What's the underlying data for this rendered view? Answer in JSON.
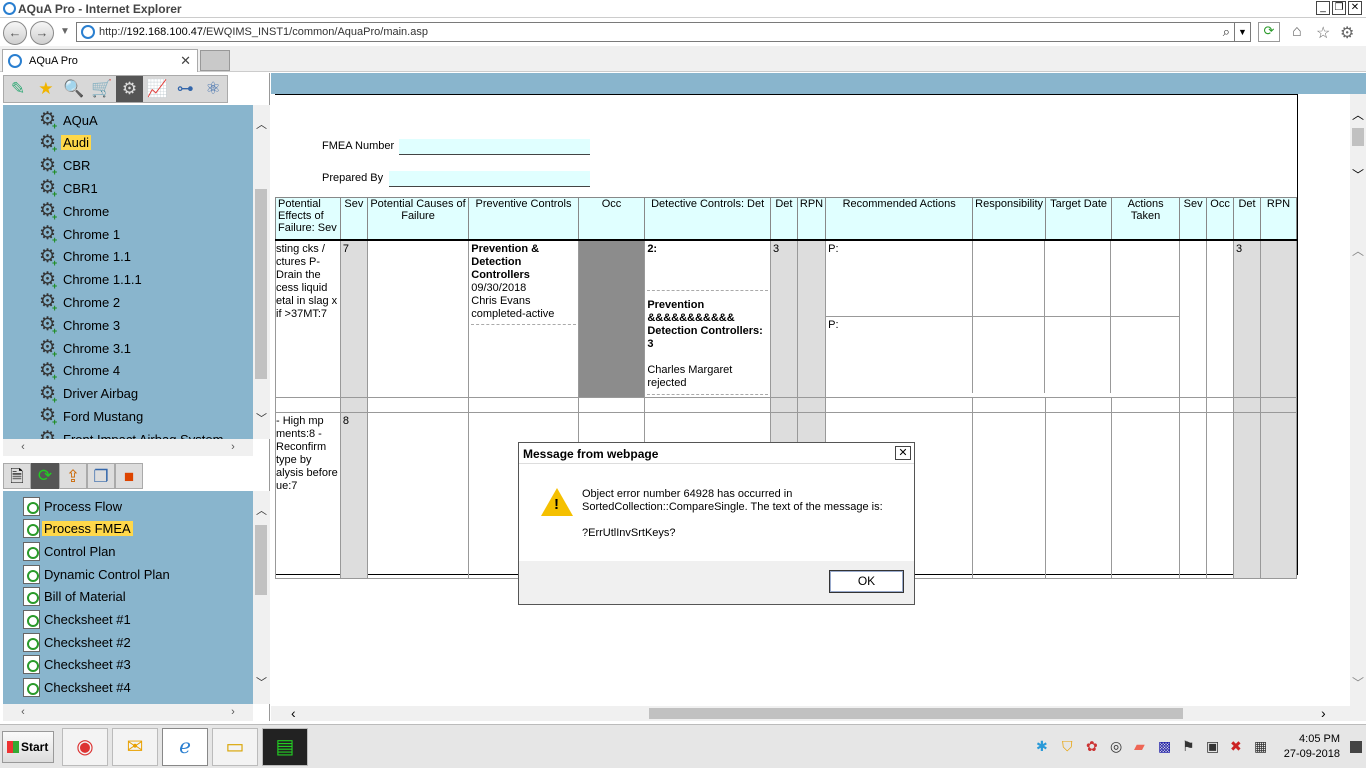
{
  "window": {
    "title": "AQuA Pro - Internet Explorer"
  },
  "address": {
    "prefix": "http://",
    "host": "192.168.100.47",
    "path": "/EWQIMS_INST1/common/AquaPro/main.asp"
  },
  "tab": {
    "label": "AQuA Pro"
  },
  "tree": {
    "items": [
      "AQuA",
      "Audi",
      "CBR",
      "CBR1",
      "Chrome",
      "Chrome 1",
      "Chrome 1.1",
      "Chrome 1.1.1",
      "Chrome 2",
      "Chrome 3",
      "Chrome 3.1",
      "Chrome 4",
      "Driver Airbag",
      "Ford Mustang",
      "Front Impact Airbag System"
    ],
    "selected": "Audi"
  },
  "docs": {
    "items": [
      "Process Flow",
      "Process FMEA",
      "Control Plan",
      "Dynamic Control Plan",
      "Bill of Material",
      "Checksheet #1",
      "Checksheet #2",
      "Checksheet #3",
      "Checksheet #4"
    ],
    "selected": "Process FMEA"
  },
  "form": {
    "fmea_label": "FMEA Number",
    "prepared_label": "Prepared By"
  },
  "grid": {
    "headers": [
      "Potential Effects of Failure: Sev",
      "Sev",
      "Potential Causes of Failure",
      "Preventive Controls",
      "Occ",
      "Detective Controls: Det",
      "Det",
      "RPN",
      "Recommended Actions",
      "Responsibility",
      "Target Date",
      "Actions Taken",
      "Sev",
      "Occ",
      "Det",
      "RPN"
    ],
    "row1": {
      "effects": "sting cks / ctures P- Drain the cess liquid etal in slag x if >37MT:7",
      "sev": "7",
      "prev_title": "Prevention & Detection Controllers",
      "prev_date": "09/30/2018",
      "prev_person": "Chris Evans",
      "prev_status": "completed-active",
      "det1": "2:",
      "det2_title": "Prevention &&&&&&&&&&& Detection Controllers: 3",
      "det2_person": "Charles Margaret",
      "det2_status": "rejected",
      "det": "3",
      "rec1": "P:",
      "rec2": "P:",
      "det_after": "3"
    },
    "row2": {
      "effects": "- High mp ments:8 - Reconfirm type by alysis before ue:7",
      "sev": "8"
    }
  },
  "dialog": {
    "title": "Message from webpage",
    "line1": "Object error number 64928 has occurred in",
    "line2": "SortedCollection::CompareSingle.  The text of the message is:",
    "line3": "?ErrUtlInvSrtKeys?",
    "ok": "OK"
  },
  "taskbar": {
    "start": "Start",
    "time": "4:05 PM",
    "date": "27-09-2018"
  }
}
